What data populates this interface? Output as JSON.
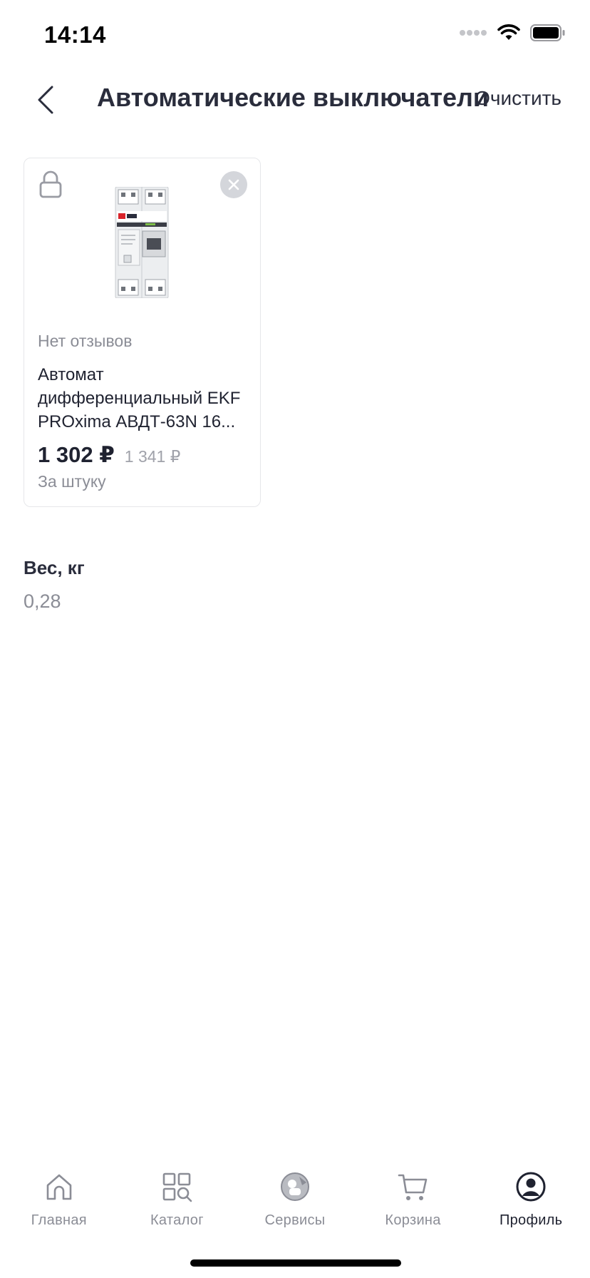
{
  "status_bar": {
    "time": "14:14"
  },
  "nav": {
    "title": "Автоматические выключатели",
    "clear_label": "Очистить"
  },
  "product": {
    "reviews": "Нет отзывов",
    "name_line1": "Автомат",
    "name_line2": "дифференциальный EKF",
    "name_line3": "PROxima АВДТ-63N 16...",
    "price": "1 302 ₽",
    "old_price": "1 341 ₽",
    "unit": "За штуку"
  },
  "attribute": {
    "label": "Вес, кг",
    "value": "0,28"
  },
  "tabs": [
    {
      "label": "Главная",
      "icon": "home-icon"
    },
    {
      "label": "Каталог",
      "icon": "catalog-icon"
    },
    {
      "label": "Сервисы",
      "icon": "services-icon"
    },
    {
      "label": "Корзина",
      "icon": "cart-icon"
    },
    {
      "label": "Профиль",
      "icon": "profile-icon",
      "active": true
    }
  ],
  "colors": {
    "text": "#1f2230",
    "muted": "#8b8d96",
    "border": "#e6e7ea"
  }
}
